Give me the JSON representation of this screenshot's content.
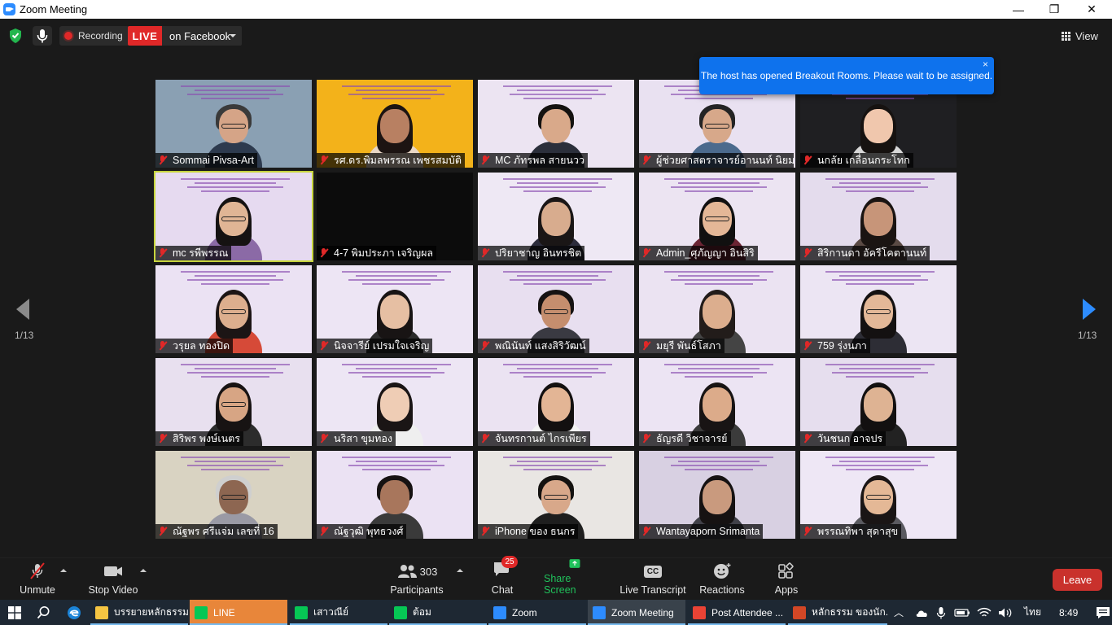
{
  "window": {
    "title": "Zoom Meeting",
    "minimize": "—",
    "maximize": "❐",
    "close": "✕"
  },
  "topbar": {
    "recording_label": "Recording",
    "live_label": "LIVE",
    "live_destination": "on Facebook",
    "view_label": "View"
  },
  "toast": {
    "message": "The host has opened Breakout Rooms. Please wait to be assigned.",
    "close": "×"
  },
  "pager": {
    "left_indicator": "1/13",
    "right_indicator": "1/13"
  },
  "participants": [
    {
      "name": "Sommai Pivsa-Art",
      "bg": "#8aa0b3",
      "skin": "#d5a487",
      "hair": "#3a3a3a",
      "shirt": "#2d3a4e",
      "glasses": true,
      "short": true
    },
    {
      "name": "รศ.ดร.พิมลพรรณ เพชรสมบัติ",
      "bg": "#f3b21a",
      "skin": "#b88062",
      "hair": "#1c1412",
      "shirt": "#e9d7c6",
      "glasses": false,
      "short": false
    },
    {
      "name": "MC ภัทรพล สายนวว",
      "bg": "#ece4f2",
      "skin": "#d9a98a",
      "hair": "#141210",
      "shirt": "#2b2f3b",
      "glasses": false,
      "short": true
    },
    {
      "name": "ผู้ช่วยศาสตราจารย์อานนท์ นิยม...",
      "bg": "#e9e1f1",
      "skin": "#d7a88a",
      "hair": "#242424",
      "shirt": "#4b6a8d",
      "glasses": true,
      "short": true
    },
    {
      "name": "นกลัย เกลื่อนกระโทก",
      "bg": "#1f1f22",
      "skin": "#f0c7ad",
      "hair": "#161210",
      "shirt": "#d8d8d8",
      "glasses": false,
      "short": false
    },
    {
      "name": "mc รพีพรรณ",
      "bg": "#e6daf0",
      "skin": "#e0b595",
      "hair": "#151212",
      "shirt": "#8b6aa6",
      "glasses": true,
      "short": false
    },
    {
      "name": "4-7 พิมประภา เจริญผล",
      "bg": "#0c0c0c",
      "skin": "#0c0c0c",
      "hair": "#0c0c0c",
      "shirt": "#0c0c0c",
      "glasses": false,
      "short": false
    },
    {
      "name": "ปริยาชาญ  อินทรชิต",
      "bg": "#eee8f4",
      "skin": "#d8ac8e",
      "hair": "#1a1616",
      "shirt": "#2c2c3c",
      "glasses": false,
      "short": false
    },
    {
      "name": "Admin_ศุภัญญา อินสิริ",
      "bg": "#ece4f2",
      "skin": "#e4b797",
      "hair": "#111010",
      "shirt": "#6b2433",
      "glasses": true,
      "short": false
    },
    {
      "name": "สิริกานดา อัครีโคตานนท์",
      "bg": "#e4dced",
      "skin": "#c79579",
      "hair": "#1a1412",
      "shirt": "#5a4a44",
      "glasses": false,
      "short": false
    },
    {
      "name": "วรุยล ทองปิด",
      "bg": "#ebe2f3",
      "skin": "#dcae8e",
      "hair": "#1c1515",
      "shirt": "#d64a38",
      "glasses": true,
      "short": false
    },
    {
      "name": "นิจจารีย์ เปรมใจเจริญ",
      "bg": "#ede5f4",
      "skin": "#e6bfa3",
      "hair": "#181414",
      "shirt": "#2c2c2c",
      "glasses": false,
      "short": false
    },
    {
      "name": "พณินันท์ แสงสิริวัฒน์",
      "bg": "#e8dff0",
      "skin": "#c58e6e",
      "hair": "#151212",
      "shirt": "#3a3a42",
      "glasses": true,
      "short": true
    },
    {
      "name": "มยุรี พันธ์โสภา",
      "bg": "#ebe3f2",
      "skin": "#dcae8e",
      "hair": "#221c1a",
      "shirt": "#444",
      "glasses": false,
      "short": false
    },
    {
      "name": "759 รุ่งนภา",
      "bg": "#ece5f3",
      "skin": "#e3b898",
      "hair": "#141111",
      "shirt": "#2d2d35",
      "glasses": true,
      "short": false
    },
    {
      "name": "สิริพร พงษ์เนตร",
      "bg": "#e8e0ef",
      "skin": "#d7a584",
      "hair": "#171313",
      "shirt": "#2c2c2c",
      "glasses": true,
      "short": false
    },
    {
      "name": "นริสา ขุมทอง",
      "bg": "#ede6f4",
      "skin": "#efcdb5",
      "hair": "#1a1515",
      "shirt": "#efefef",
      "glasses": false,
      "short": false
    },
    {
      "name": "จันทรกานต์ ไกรเพียร",
      "bg": "#ebe3f2",
      "skin": "#e3b595",
      "hair": "#131010",
      "shirt": "#f4f4f4",
      "glasses": false,
      "short": false
    },
    {
      "name": "ธัญรดี วิชาจารย์",
      "bg": "#ece4f3",
      "skin": "#dcab8a",
      "hair": "#181414",
      "shirt": "#3b3b3b",
      "glasses": false,
      "short": false
    },
    {
      "name": "วันชนก อาจปร",
      "bg": "#e6deee",
      "skin": "#deb393",
      "hair": "#121010",
      "shirt": "#222",
      "glasses": false,
      "short": false
    },
    {
      "name": "ณัฐพร ศรีแจ่ม เลขที่ 16",
      "bg": "#d9d3c2",
      "skin": "#8d6651",
      "hair": "#cfcfcf",
      "shirt": "#9a9aa5",
      "glasses": true,
      "short": true
    },
    {
      "name": "ณัฐวุฒิ  พุทธวงศ์",
      "bg": "#ebe2f3",
      "skin": "#a8765c",
      "hair": "#161212",
      "shirt": "#3a3a3a",
      "glasses": false,
      "short": true
    },
    {
      "name": "iPhone ของ ธนกร",
      "bg": "#e9e6e3",
      "skin": "#d8a88a",
      "hair": "#141210",
      "shirt": "#1e1e1e",
      "glasses": true,
      "short": true
    },
    {
      "name": "Wantayaporn Srimanta",
      "bg": "#d8d0e2",
      "skin": "#c99a7e",
      "hair": "#161212",
      "shirt": "#404048",
      "glasses": false,
      "short": false
    },
    {
      "name": "พรรณทิพา สุดาสุข",
      "bg": "#eee7f5",
      "skin": "#e4b896",
      "hair": "#1a1515",
      "shirt": "#5a5a60",
      "glasses": true,
      "short": false
    }
  ],
  "toolbar": {
    "unmute": "Unmute",
    "stop_video": "Stop Video",
    "participants": "Participants",
    "participants_count": "303",
    "chat": "Chat",
    "chat_badge": "25",
    "share_screen": "Share Screen",
    "live_transcript": "Live Transcript",
    "cc_icon_text": "CC",
    "reactions": "Reactions",
    "apps": "Apps",
    "leave": "Leave"
  },
  "taskbar": {
    "items": [
      {
        "label": "บรรยายหลักธรรม",
        "color": "#f5c542"
      },
      {
        "label": "LINE",
        "color": "#06c755"
      },
      {
        "label": "เสาวณีย์",
        "color": "#06c755"
      },
      {
        "label": "ต้อม",
        "color": "#06c755"
      },
      {
        "label": "Zoom",
        "color": "#2d8cff"
      },
      {
        "label": "Zoom Meeting",
        "color": "#2d8cff"
      },
      {
        "label": "Post Attendee ...",
        "color": "#ea4335"
      },
      {
        "label": "หลักธรรม ของนัก...",
        "color": "#d24726"
      }
    ],
    "lang": "ไทย",
    "time": "8:49"
  }
}
